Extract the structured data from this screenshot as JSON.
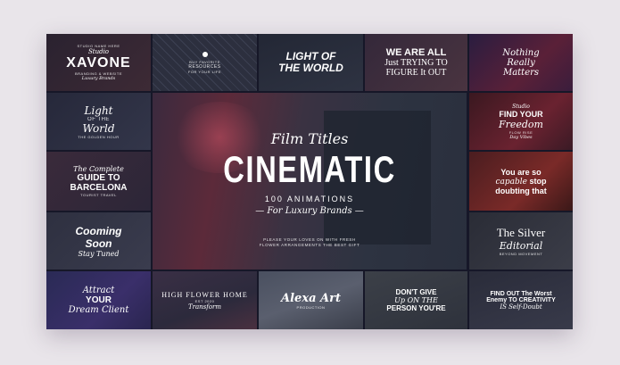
{
  "center": {
    "script_title": "Film Titles",
    "main_title": "CINEMATIC",
    "subtitle": "100 ANIMATIONS",
    "tagline": "— For Luxury Brands —",
    "note_line1": "PLEASE YOUR LOVES ON WITH FRESH",
    "note_line2": "FLOWER ARRANGEMENTS THE BEST GIFT"
  },
  "tiles": {
    "xavone": {
      "small1": "STUDIO NAME HERE",
      "script": "Studio",
      "title": "XAVONE",
      "small2": "BRANDING & WEBSITE",
      "script2": "Luxury Brands"
    },
    "neon_fence": {
      "small1": "BUY FAVORITE",
      "small2": "RESOURCES",
      "small3": "FOR YOUR LIFE"
    },
    "light_world": {
      "title": "LIGHT OF THE WORLD"
    },
    "we_are_all": {
      "line1": "WE ARE ALL",
      "line2": "Just TRYING TO",
      "line3": "FIGURE It OUT"
    },
    "nothing": {
      "line1": "Nothing",
      "line2": "Really",
      "line3": "Matters"
    },
    "light_script": {
      "line1": "Light",
      "line2": "OF THE",
      "line3": "World",
      "small": "The Golden Hour"
    },
    "freedom": {
      "script": "Studio",
      "line1": "FIND YOUR",
      "line2": "Freedom",
      "line3": "FLOW  RISE",
      "small": "Day Vibes"
    },
    "barcelona": {
      "script": "The Complete",
      "line1": "GUIDE TO",
      "line2": "BARCELONA",
      "small": "Tourist Travel"
    },
    "capable": {
      "line1": "You are so",
      "line2": "capable",
      "line3": "stop",
      "line4": "doubting that"
    },
    "coming_soon": {
      "line1": "Cooming",
      "line2": "Soon",
      "line3": "Stay Tuned"
    },
    "silver": {
      "line1": "The Silver",
      "line2": "Editorial",
      "small": "BEYOND MOVEMENT"
    },
    "attract": {
      "line1": "Attract",
      "line2": "YOUR",
      "line3": "Dream Client"
    },
    "high_flower": {
      "line1": "HIGH FLOWER HOME",
      "small": "EST 2020",
      "script": "Transform"
    },
    "alexa": {
      "title": "Alexa Art",
      "small": "Production"
    },
    "dont_give": {
      "line1": "DON'T GIVE",
      "line2": "Up ON THE",
      "line3": "PERSON YOU'RE"
    },
    "find_out": {
      "line1": "FIND OUT The Worst",
      "line2": "Enemy TO CREATIVITY",
      "line3": "IS Self-Doubt"
    }
  }
}
